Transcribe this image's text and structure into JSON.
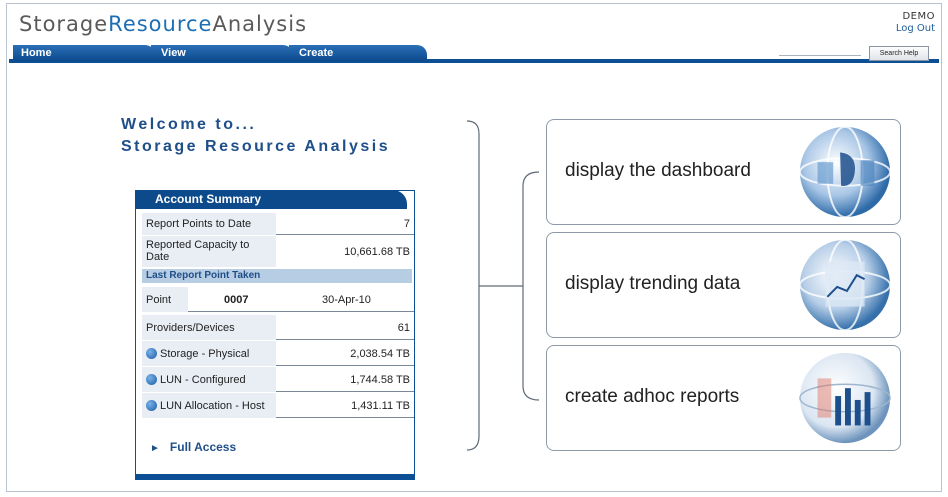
{
  "brand": {
    "part1": "Storage",
    "part2": "Resource",
    "part3": "Analysis"
  },
  "user": {
    "name": "DEMO",
    "logout": "Log Out"
  },
  "nav": {
    "tabs": [
      "Home",
      "View",
      "Create"
    ],
    "search_button": "Search Help"
  },
  "welcome": {
    "line1": "Welcome to...",
    "line2": "Storage Resource Analysis"
  },
  "account": {
    "title": "Account Summary",
    "report_points_label": "Report Points to Date",
    "report_points_value": "7",
    "capacity_label": "Reported Capacity to Date",
    "capacity_value": "10,661.68 TB",
    "last_point_header": "Last Report Point Taken",
    "point_label": "Point",
    "point_number": "0007",
    "point_date": "30-Apr-10",
    "providers_label": "Providers/Devices",
    "providers_value": "61",
    "storage_label": "Storage - Physical",
    "storage_value": "2,038.54 TB",
    "lun_label": "LUN - Configured",
    "lun_value": "1,744.58 TB",
    "lun_alloc_label": "LUN Allocation - Host",
    "lun_alloc_value": "1,431.11 TB",
    "full_access": "Full Access"
  },
  "actions": [
    {
      "label": "display the dashboard"
    },
    {
      "label": "display trending data"
    },
    {
      "label": "create adhoc reports"
    }
  ],
  "colors": {
    "brand_accent": "#1d6fb5",
    "nav_blue": "#0d4a8c",
    "subhead_bg": "#b7cde4"
  }
}
